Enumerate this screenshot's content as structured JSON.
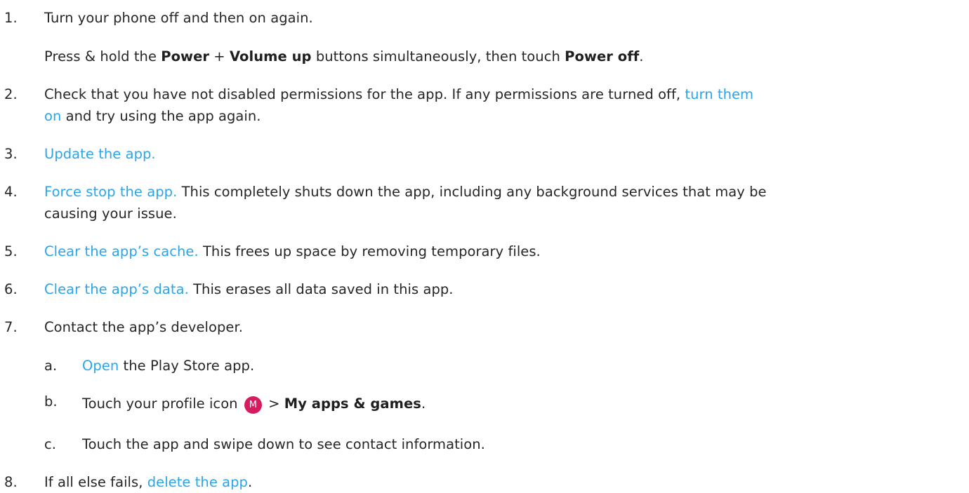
{
  "steps": [
    {
      "num": "1.",
      "text": "Turn your phone off and then on again.",
      "detail": {
        "pre": "Press & hold the ",
        "b1": "Power",
        "plus": " + ",
        "b2": "Volume up",
        "mid": " buttons simultaneously, then touch ",
        "b3": "Power off",
        "end": "."
      }
    },
    {
      "num": "2.",
      "pre": "Check that you have not disabled permissions for the app. If any permissions are turned off, ",
      "link1": "turn them",
      "link2": "on",
      "post": " and try using the app again."
    },
    {
      "num": "3.",
      "link": "Update the app."
    },
    {
      "num": "4.",
      "link": "Force stop the app.",
      "line1": " This completely shuts down the app, including any background services that may be",
      "line2": "causing your issue."
    },
    {
      "num": "5.",
      "link": "Clear the app’s cache.",
      "post": " This frees up space by removing temporary files."
    },
    {
      "num": "6.",
      "link": "Clear the app’s data.",
      "post": " This erases all data saved in this app."
    },
    {
      "num": "7.",
      "text": "Contact the app’s developer.",
      "substeps": [
        {
          "letter": "a.",
          "link": "Open",
          "post": " the Play Store app."
        },
        {
          "letter": "b.",
          "pre": "Touch your profile icon",
          "avatar": "M",
          "gt": " > ",
          "bold": "My apps & games",
          "end": "."
        },
        {
          "letter": "c.",
          "text": "Touch the app and swipe down to see contact information."
        }
      ]
    },
    {
      "num": "8.",
      "pre": "If all else fails, ",
      "link": "delete the app",
      "end": "."
    }
  ],
  "colors": {
    "text": "#262626",
    "link": "#2aa5ea",
    "avatar_bg": "#d81b60"
  },
  "icons": {
    "profile": "profile-avatar-icon"
  }
}
